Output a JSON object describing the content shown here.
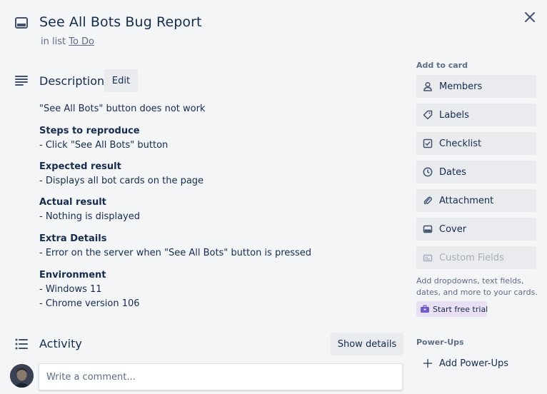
{
  "card": {
    "title": "See All Bots Bug Report",
    "in_list_prefix": "in list",
    "list_name": "To Do"
  },
  "icons": {
    "card": "card-icon",
    "close": "close-icon",
    "description": "description-icon",
    "activity": "activity-icon"
  },
  "description": {
    "heading": "Description",
    "edit_label": "Edit",
    "intro": "\"See All Bots\" button does not work",
    "sections": [
      {
        "title": "Steps to reproduce",
        "lines": [
          "- Click \"See All Bots\" button"
        ]
      },
      {
        "title": "Expected result",
        "lines": [
          "- Displays all bot cards on the page"
        ]
      },
      {
        "title": "Actual result",
        "lines": [
          "- Nothing is displayed"
        ]
      },
      {
        "title": "Extra Details",
        "lines": [
          "- Error on the server when \"See All Bots\" button is pressed"
        ]
      },
      {
        "title": "Environment",
        "lines": [
          "- Windows 11",
          "- Chrome version 106"
        ]
      }
    ]
  },
  "activity": {
    "heading": "Activity",
    "show_details_label": "Show details",
    "comment_placeholder": "Write a comment..."
  },
  "sidebar": {
    "add_to_card_heading": "Add to card",
    "buttons": [
      {
        "label": "Members",
        "icon": "person-icon"
      },
      {
        "label": "Labels",
        "icon": "tag-icon"
      },
      {
        "label": "Checklist",
        "icon": "checkbox-icon"
      },
      {
        "label": "Dates",
        "icon": "clock-icon"
      },
      {
        "label": "Attachment",
        "icon": "paperclip-icon"
      },
      {
        "label": "Cover",
        "icon": "cover-icon"
      },
      {
        "label": "Custom Fields",
        "icon": "custom-fields-icon"
      }
    ],
    "custom_fields_text": "Add dropdowns, text fields, dates, and more to your cards.",
    "trial_label": "Start free trial",
    "powerups_heading": "Power-Ups",
    "add_powerups_label": "Add Power-Ups"
  },
  "colors": {
    "background": "#f4f5f7",
    "button": "#e9ebee",
    "text": "#172b4d",
    "muted": "#5e6c84",
    "trial_bg": "#eae0f4"
  }
}
